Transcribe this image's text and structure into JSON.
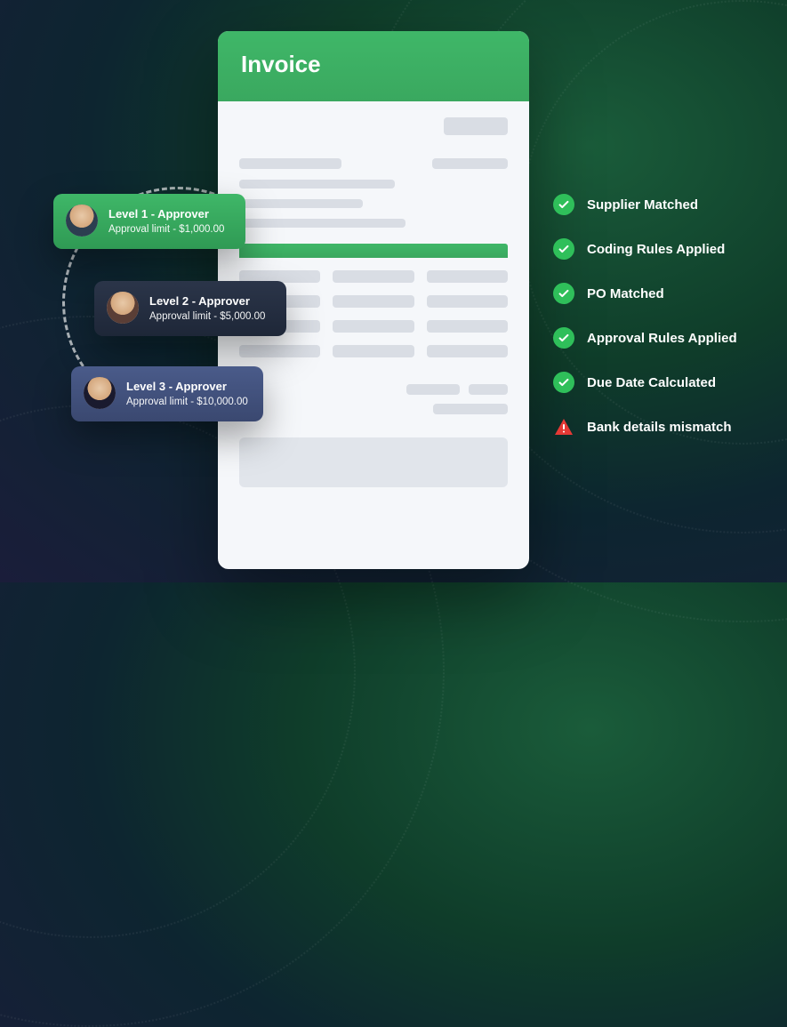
{
  "invoice": {
    "title": "Invoice"
  },
  "approvers": [
    {
      "title": "Level 1 - Approver",
      "subtitle": "Approval limit - $1,000.00"
    },
    {
      "title": "Level 2 - Approver",
      "subtitle": "Approval limit - $5,000.00"
    },
    {
      "title": "Level 3 - Approver",
      "subtitle": "Approval limit - $10,000.00"
    }
  ],
  "statuses": [
    {
      "label": "Supplier Matched",
      "type": "check"
    },
    {
      "label": "Coding Rules Applied",
      "type": "check"
    },
    {
      "label": "PO Matched",
      "type": "check"
    },
    {
      "label": "Approval Rules Applied",
      "type": "check"
    },
    {
      "label": "Due Date Calculated",
      "type": "check"
    },
    {
      "label": "Bank details mismatch",
      "type": "warn"
    }
  ]
}
